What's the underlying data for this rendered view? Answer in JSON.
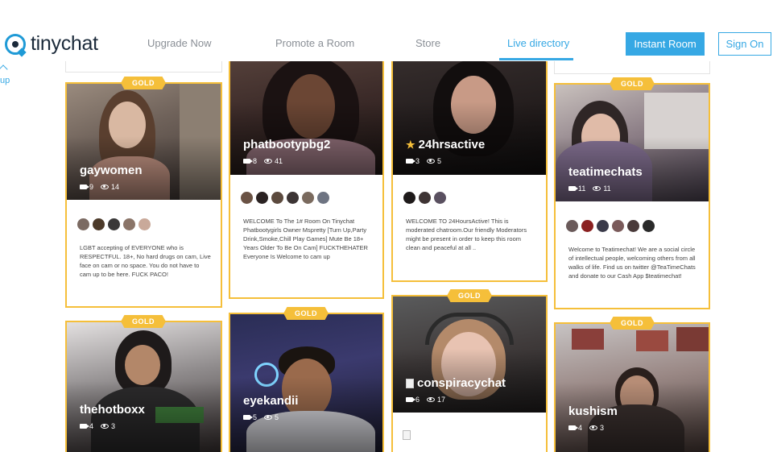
{
  "header": {
    "logo_text": "tinychat",
    "nav": [
      "Upgrade Now",
      "Promote a Room",
      "Store",
      "Live directory"
    ],
    "instant_room": "Instant Room",
    "sign_on": "Sign On"
  },
  "sidebar_fragment": {
    "text": "up"
  },
  "badge_label": "GOLD",
  "rooms": [
    {
      "name": "gaywomen",
      "cams": "9",
      "viewers": "14",
      "gold": true,
      "description": "LGBT accepting of EVERYONE who is RESPECTFUL. 18+, No hard drugs on cam, Live face on cam or no space. You do not have to cam up to be here. FUCK PACO!"
    },
    {
      "name": "phatbootypbg2",
      "cams": "8",
      "viewers": "41",
      "gold": true,
      "description": "WELCOME To The 1# Room On Tinychat Phatbootygirls Owner Mspretty [Turn Up,Party Drink,Smoke,Chill Play Games] Mute Be 18+ Years Older To Be On Cam] FUCKTHEHATER Everyone Is Welcome to cam up"
    },
    {
      "name": "24hrsactive",
      "cams": "3",
      "viewers": "5",
      "gold": true,
      "starred": true,
      "description": "WELCOME TO 24HoursActive! This is moderated chatroom.Our friendly Moderators might be present in order to keep this room clean and peaceful at all .."
    },
    {
      "name": "teatimechats",
      "cams": "11",
      "viewers": "11",
      "gold": true,
      "description": "Welcome to Teatimechat! We are a social circle of intellectual people, welcoming others from all walks of life. Find us on twitter @TeaTimeChats and donate to our Cash App $teatimechat!"
    },
    {
      "name": "thehotboxx",
      "cams": "4",
      "viewers": "3",
      "gold": true
    },
    {
      "name": "eyekandii",
      "cams": "5",
      "viewers": "5",
      "gold": true
    },
    {
      "name": "conspiracychat",
      "cams": "6",
      "viewers": "17",
      "gold": true
    },
    {
      "name": "kushism",
      "cams": "4",
      "viewers": "3",
      "gold": true
    }
  ],
  "colors": {
    "accent": "#36a8e4",
    "gold": "#f5bf3a",
    "logo_dark": "#1b2a3a"
  }
}
